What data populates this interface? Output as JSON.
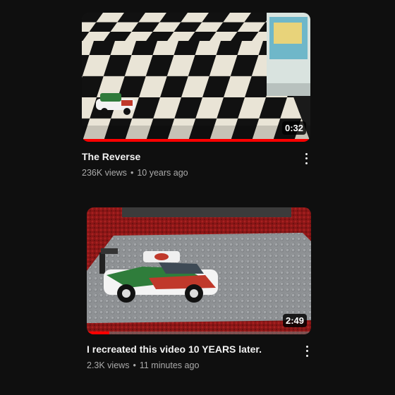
{
  "videos": [
    {
      "title": "The Reverse",
      "views": "236K views",
      "separator": "•",
      "age": "10 years ago",
      "duration": "0:32",
      "progress": 1.0,
      "thumbnail_icon": "checkerboard-floor-race-car-thumbnail"
    },
    {
      "title": "I recreated this video 10 YEARS later.",
      "views": "2.3K views",
      "separator": "•",
      "age": "11 minutes ago",
      "duration": "2:49",
      "progress": 0.1,
      "thumbnail_icon": "lego-race-car-baseplate-thumbnail"
    }
  ],
  "colors": {
    "background": "#0f0f0f",
    "progress": "#ff0000",
    "title": "#f1f1f1",
    "meta": "#aaaaaa"
  }
}
